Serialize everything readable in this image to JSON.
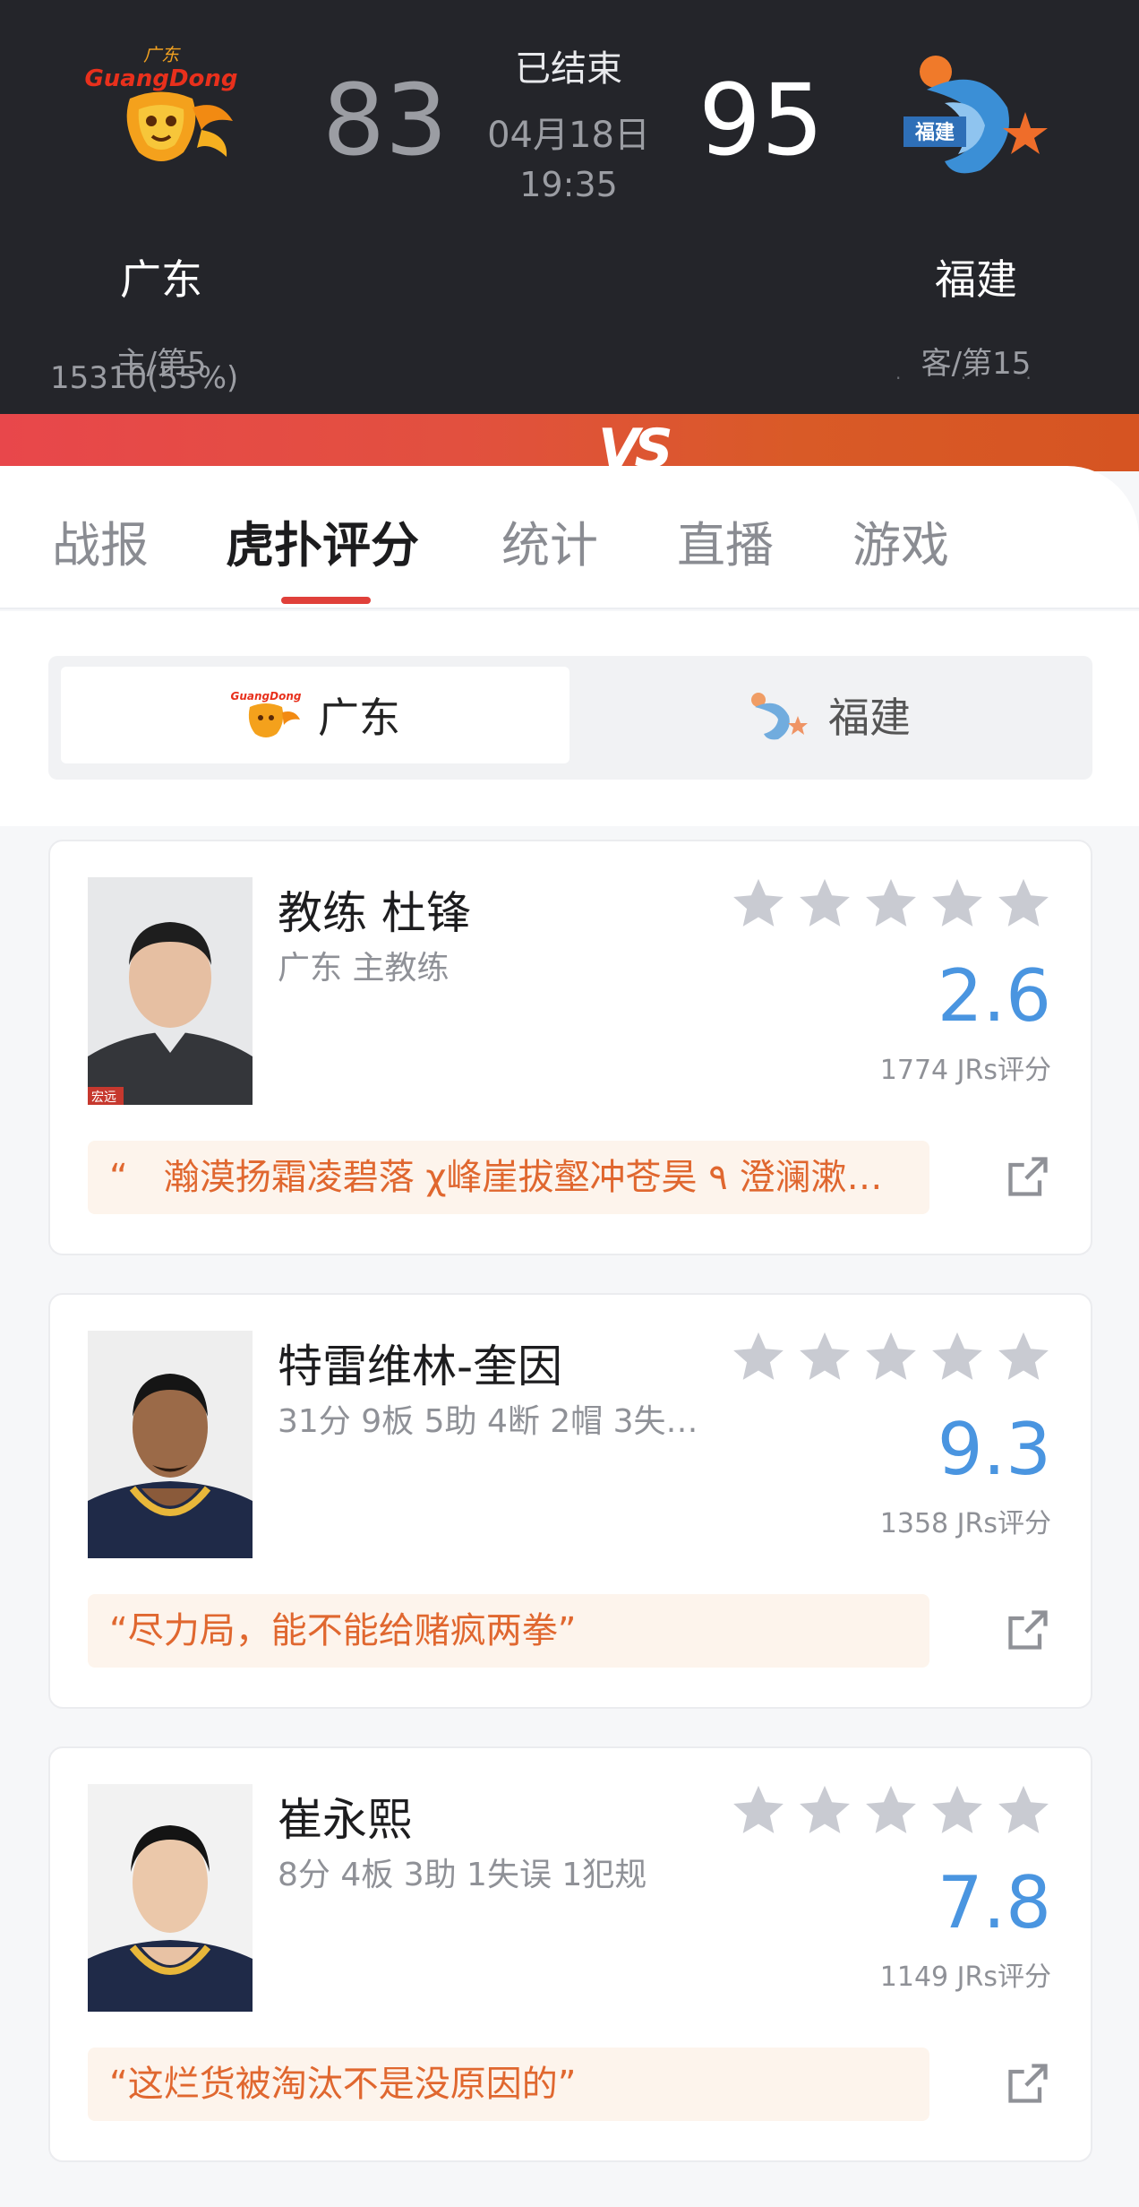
{
  "match": {
    "status": "已结束",
    "date": "04月18日",
    "time": "19:35",
    "home": {
      "name": "广东",
      "sub": "主/第5",
      "support": "15310(55%)",
      "score": "83",
      "logo_text": "GuangDong",
      "logo_cn": "广东"
    },
    "away": {
      "name": "福建",
      "sub": "客/第15",
      "score": "95",
      "logo_text": "福建"
    },
    "vs": "VS"
  },
  "tabs": [
    {
      "label": "战报",
      "active": false
    },
    {
      "label": "虎扑评分",
      "active": true
    },
    {
      "label": "统计",
      "active": false
    },
    {
      "label": "直播",
      "active": false
    },
    {
      "label": "游戏",
      "active": false
    }
  ],
  "team_switch": {
    "left": "广东",
    "right": "福建",
    "selected": "广东"
  },
  "cards": [
    {
      "name": "教练 杜锋",
      "desc": "广东 主教练",
      "rating": "2.6",
      "votes": "1774 JRs评分",
      "quote": "“　瀚漠扬霜凌碧落 χ峰崖拔壑冲苍昊 ٩ 澄澜漱…",
      "jersey_text": "宏远"
    },
    {
      "name": "特雷维林-奎因",
      "desc": "31分 9板 5助 4断 2帽 3失…",
      "rating": "9.3",
      "votes": "1358 JRs评分",
      "quote": "“尽力局，能不能给赌疯两拳”"
    },
    {
      "name": "崔永熙",
      "desc": "8分 4板 3助 1失误 1犯规",
      "rating": "7.8",
      "votes": "1149 JRs评分",
      "quote": "“这烂货被淘汰不是没原因的”"
    }
  ],
  "colors": {
    "header_bg": "#24252a",
    "accent_red": "#e0403a",
    "rating_blue": "#4a95e0",
    "quote_orange": "#e0672f",
    "star_gray": "#c9cbd2"
  },
  "icons": [
    "guangdong-logo",
    "fujian-logo",
    "star-icon",
    "share-icon"
  ]
}
